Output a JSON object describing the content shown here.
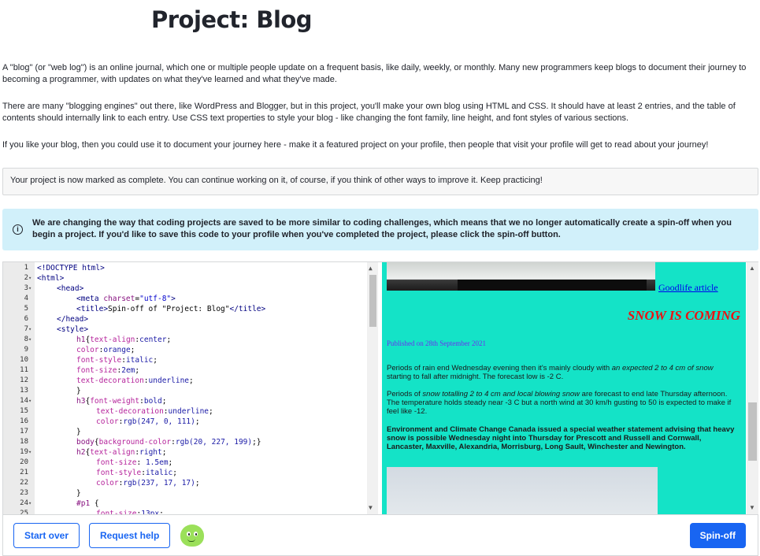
{
  "page": {
    "title": "Project: Blog",
    "paragraphs": [
      "A \"blog\" (or \"web log\") is an online journal, which one or multiple people update on a frequent basis, like daily, weekly, or monthly. Many new programmers keep blogs to document their journey to becoming a programmer, with updates on what they've learned and what they've made.",
      "There are many \"blogging engines\" out there, like WordPress and Blogger, but in this project, you'll make your own blog using HTML and CSS. It should have at least 2 entries, and the table of contents should internally link to each entry. Use CSS text properties to style your blog - like changing the font family, line height, and font styles of various sections.",
      "If you like your blog, then you could use it to document your journey here - make it a featured project on your profile, then people that visit your profile will get to read about your journey!"
    ],
    "complete_notice": "Your project is now marked as complete. You can continue working on it, of course, if you think of other ways to improve it. Keep practicing!",
    "info_notice": "We are changing the way that coding projects are saved to be more similar to coding challenges, which means that we no longer automatically create a spin-off when you begin a project. If you'd like to save this code to your profile when you've completed the project, please click the spin-off button.",
    "info_icon": "info-circle-icon"
  },
  "editor": {
    "lines": [
      {
        "n": "1",
        "fold": false,
        "indent": 0,
        "parts": [
          [
            "t-tag",
            "<!DOCTYPE html>"
          ]
        ]
      },
      {
        "n": "2",
        "fold": true,
        "indent": 0,
        "parts": [
          [
            "t-tag",
            "<html>"
          ]
        ]
      },
      {
        "n": "3",
        "fold": true,
        "indent": 1,
        "parts": [
          [
            "t-tag",
            "<head>"
          ]
        ]
      },
      {
        "n": "4",
        "fold": false,
        "indent": 2,
        "parts": [
          [
            "t-tag",
            "<meta "
          ],
          [
            "t-sel",
            "charset"
          ],
          [
            "t-plain",
            "="
          ],
          [
            "t-str",
            "\"utf-8\""
          ],
          [
            "t-tag",
            ">"
          ]
        ]
      },
      {
        "n": "5",
        "fold": false,
        "indent": 2,
        "parts": [
          [
            "t-tag",
            "<title>"
          ],
          [
            "t-plain",
            "Spin-off of \"Project: Blog\""
          ],
          [
            "t-tag",
            "</title>"
          ]
        ]
      },
      {
        "n": "6",
        "fold": false,
        "indent": 1,
        "parts": [
          [
            "t-tag",
            "</head>"
          ]
        ]
      },
      {
        "n": "7",
        "fold": true,
        "indent": 1,
        "parts": [
          [
            "t-tag",
            "<style>"
          ]
        ]
      },
      {
        "n": "8",
        "fold": true,
        "indent": 2,
        "parts": [
          [
            "t-sel",
            "h1"
          ],
          [
            "t-plain",
            "{"
          ],
          [
            "t-prop",
            "text-align"
          ],
          [
            "t-plain",
            ":"
          ],
          [
            "t-val",
            "center"
          ],
          [
            "t-plain",
            ";"
          ]
        ]
      },
      {
        "n": "9",
        "fold": false,
        "indent": 2,
        "parts": [
          [
            "t-prop",
            "color"
          ],
          [
            "t-plain",
            ":"
          ],
          [
            "t-val",
            "orange"
          ],
          [
            "t-plain",
            ";"
          ]
        ]
      },
      {
        "n": "10",
        "fold": false,
        "indent": 2,
        "parts": [
          [
            "t-prop",
            "font-style"
          ],
          [
            "t-plain",
            ":"
          ],
          [
            "t-val",
            "italic"
          ],
          [
            "t-plain",
            ";"
          ]
        ]
      },
      {
        "n": "11",
        "fold": false,
        "indent": 2,
        "parts": [
          [
            "t-prop",
            "font-size"
          ],
          [
            "t-plain",
            ":"
          ],
          [
            "t-val",
            "2em"
          ],
          [
            "t-plain",
            ";"
          ]
        ]
      },
      {
        "n": "12",
        "fold": false,
        "indent": 2,
        "parts": [
          [
            "t-prop",
            "text-decoration"
          ],
          [
            "t-plain",
            ":"
          ],
          [
            "t-val",
            "underline"
          ],
          [
            "t-plain",
            ";"
          ]
        ]
      },
      {
        "n": "13",
        "fold": false,
        "indent": 2,
        "parts": [
          [
            "t-plain",
            "}"
          ]
        ]
      },
      {
        "n": "14",
        "fold": true,
        "indent": 2,
        "parts": [
          [
            "t-sel",
            "h3"
          ],
          [
            "t-plain",
            "{"
          ],
          [
            "t-prop",
            "font-weight"
          ],
          [
            "t-plain",
            ":"
          ],
          [
            "t-val",
            "bold"
          ],
          [
            "t-plain",
            ";"
          ]
        ]
      },
      {
        "n": "15",
        "fold": false,
        "indent": 3,
        "parts": [
          [
            "t-prop",
            "text-decoration"
          ],
          [
            "t-plain",
            ":"
          ],
          [
            "t-val",
            "underline"
          ],
          [
            "t-plain",
            ";"
          ]
        ]
      },
      {
        "n": "16",
        "fold": false,
        "indent": 3,
        "parts": [
          [
            "t-prop",
            "color"
          ],
          [
            "t-plain",
            ":"
          ],
          [
            "t-val",
            "rgb(247, 0, 111)"
          ],
          [
            "t-plain",
            ";"
          ]
        ]
      },
      {
        "n": "17",
        "fold": false,
        "indent": 2,
        "parts": [
          [
            "t-plain",
            "}"
          ]
        ]
      },
      {
        "n": "18",
        "fold": false,
        "indent": 2,
        "parts": [
          [
            "t-sel",
            "body"
          ],
          [
            "t-plain",
            "{"
          ],
          [
            "t-prop",
            "background-color"
          ],
          [
            "t-plain",
            ":"
          ],
          [
            "t-val",
            "rgb(20, 227, 199)"
          ],
          [
            "t-plain",
            ";}"
          ]
        ]
      },
      {
        "n": "19",
        "fold": true,
        "indent": 2,
        "parts": [
          [
            "t-sel",
            "h2"
          ],
          [
            "t-plain",
            "{"
          ],
          [
            "t-prop",
            "text-align"
          ],
          [
            "t-plain",
            ":"
          ],
          [
            "t-val",
            "right"
          ],
          [
            "t-plain",
            ";"
          ]
        ]
      },
      {
        "n": "20",
        "fold": false,
        "indent": 3,
        "parts": [
          [
            "t-prop",
            "font-size"
          ],
          [
            "t-plain",
            ": "
          ],
          [
            "t-val",
            "1.5em"
          ],
          [
            "t-plain",
            ";"
          ]
        ]
      },
      {
        "n": "21",
        "fold": false,
        "indent": 3,
        "parts": [
          [
            "t-prop",
            "font-style"
          ],
          [
            "t-plain",
            ":"
          ],
          [
            "t-val",
            "italic"
          ],
          [
            "t-plain",
            ";"
          ]
        ]
      },
      {
        "n": "22",
        "fold": false,
        "indent": 3,
        "parts": [
          [
            "t-prop",
            "color"
          ],
          [
            "t-plain",
            ":"
          ],
          [
            "t-val",
            "rgb(237, 17, 17)"
          ],
          [
            "t-plain",
            ";"
          ]
        ]
      },
      {
        "n": "23",
        "fold": false,
        "indent": 2,
        "parts": [
          [
            "t-plain",
            "}"
          ]
        ]
      },
      {
        "n": "24",
        "fold": true,
        "indent": 2,
        "parts": [
          [
            "t-sel",
            "#p1 "
          ],
          [
            "t-plain",
            "{"
          ]
        ]
      },
      {
        "n": "25",
        "fold": false,
        "indent": 3,
        "parts": [
          [
            "t-prop",
            "font-size"
          ],
          [
            "t-plain",
            ":"
          ],
          [
            "t-val",
            "13px"
          ],
          [
            "t-plain",
            ";"
          ]
        ]
      }
    ]
  },
  "preview": {
    "link_text": "Goodlife article",
    "h2": "SNOW IS COMING",
    "published": "Published on 28th September 2021",
    "para1_a": "Periods of rain end Wednesday evening then it's mainly cloudy with ",
    "para1_em": "an expected 2 to 4 cm of snow",
    "para1_b": " starting to fall after midnight. The forecast low is -2 C.",
    "para2_a": "Periods of ",
    "para2_em": "snow totalling 2 to 4 cm and local blowing snow",
    "para2_b": " are forecast to end late Thursday afternoon. The temperature holds steady near -3 C but a north wind at 30 km/h gusting to 50 is expected to make if feel like -12.",
    "para3": "Environment and Climate Change Canada issued a special weather statement advising that heavy snow is possible Wednesday night into Thursday for Prescott and Russell and Cornwall, Lancaster, Maxville, Alexandria, Morrisburg, Long Sault, Winchester and Newington."
  },
  "footer": {
    "start_over": "Start over",
    "request_help": "Request help",
    "spin_off": "Spin-off"
  },
  "colors": {
    "accent": "#1865f2",
    "preview_bg": "#14e3c7",
    "info_bg": "#d1f0fa"
  }
}
